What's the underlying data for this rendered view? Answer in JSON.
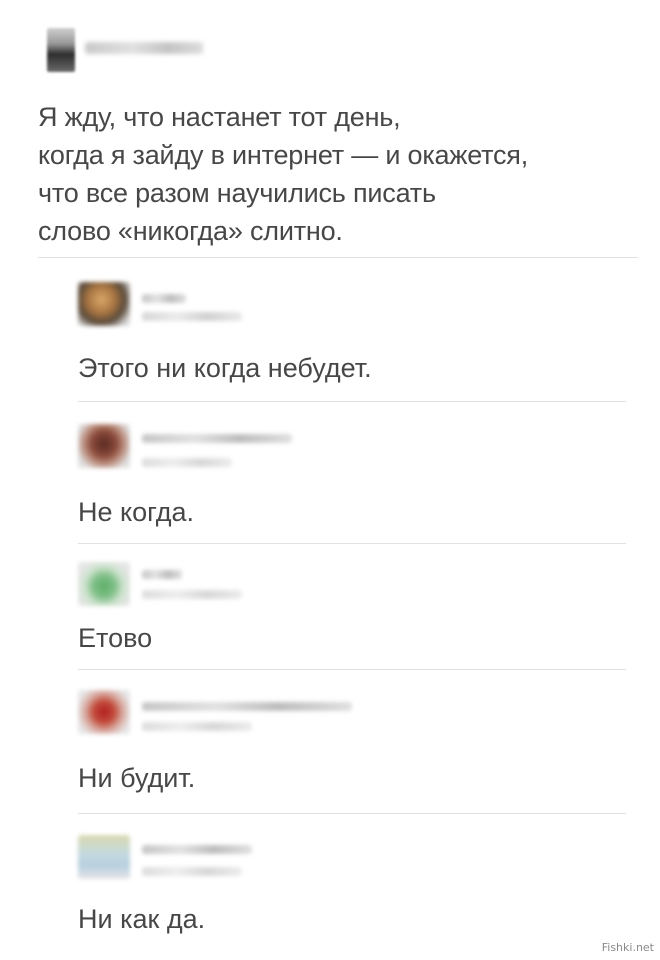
{
  "post": {
    "lines": [
      "Я жду, что настанет тот день,",
      "когда я зайду в интернет — и окажется,",
      "что все разом научились писать",
      "слово «никогда» слитно."
    ]
  },
  "comments": [
    {
      "text": "Этого ни когда небудет."
    },
    {
      "text": "Не когда."
    },
    {
      "text": "Етово"
    },
    {
      "text": "Ни будит."
    },
    {
      "text": "Ни как да."
    }
  ],
  "watermark": "Fishki.net",
  "colors": {
    "background": "#ffffff",
    "text": "#474747",
    "divider": "#e2e2e2"
  }
}
